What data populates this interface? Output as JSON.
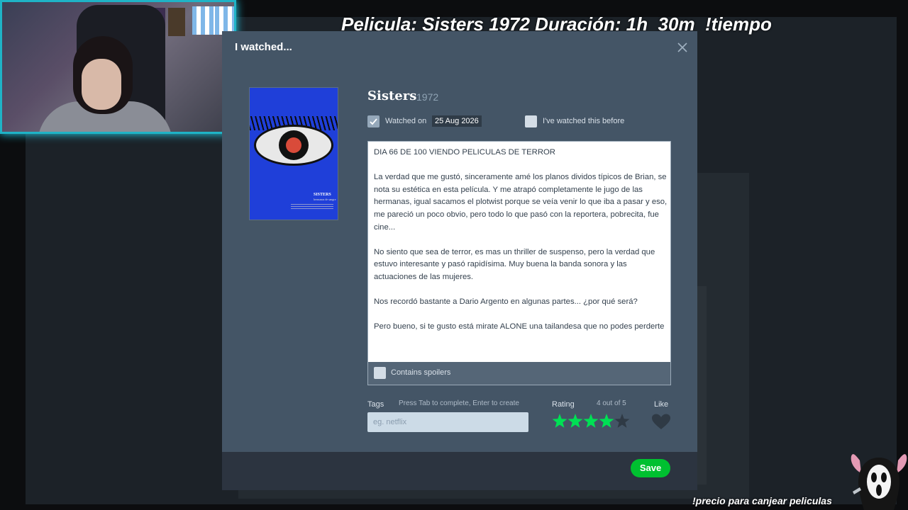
{
  "stream": {
    "title": "Pelicula: Sisters 1972 Duración: 1h  30m  !tiempo",
    "footer": "!precio para canjear peliculas"
  },
  "modal": {
    "header_title": "I watched...",
    "close_icon": "close-icon",
    "save_label": "Save"
  },
  "film": {
    "title": "Sisters",
    "year": "1972",
    "poster": {
      "title": "SISTERS",
      "subtitle": "hermanas de sangre"
    }
  },
  "watched": {
    "checked": true,
    "label": "Watched on",
    "date": "25 Aug 2026",
    "rewatch_label": "I've watched this before",
    "rewatch_checked": false
  },
  "review": {
    "text": "DIA 66 DE 100 VIENDO PELICULAS DE TERROR\n\nLa verdad que me gustó, sinceramente amé los planos dividos típicos de Brian, se nota su estética en esta película. Y me atrapó completamente le jugo de las hermanas, igual sacamos el plotwist porque se veía venir lo que iba a pasar y eso, me pareció un poco obvio, pero todo lo que pasó con la reportera, pobrecita, fue cine...\n\nNo siento que sea de terror, es mas un thriller de suspenso, pero la verdad que estuvo interesante y pasó rapidísima. Muy buena la banda sonora y las actuaciones de las mujeres.\n\nNos recordó bastante a Dario Argento en algunas partes... ¿por qué será?\n\nPero bueno, si te gusto está mirate ALONE una tailandesa que no podes perderte",
    "spoilers_label": "Contains spoilers",
    "spoilers_checked": false
  },
  "tags": {
    "label": "Tags",
    "hint": "Press Tab to complete, Enter to create",
    "placeholder": "eg. netflix"
  },
  "rating": {
    "label": "Rating",
    "value_text": "4 out of 5",
    "value": 4,
    "max": 5
  },
  "like": {
    "label": "Like",
    "liked": false
  },
  "colors": {
    "star_on": "#00e054",
    "star_off": "#2f3a45",
    "save": "#00c030"
  }
}
